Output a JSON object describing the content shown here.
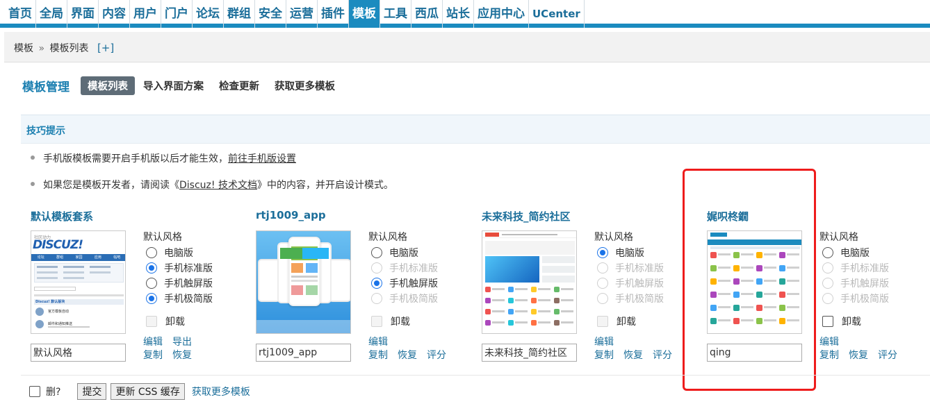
{
  "nav": {
    "items": [
      {
        "label": "首页",
        "active": false
      },
      {
        "label": "全局",
        "active": false
      },
      {
        "label": "界面",
        "active": false
      },
      {
        "label": "内容",
        "active": false
      },
      {
        "label": "用户",
        "active": false
      },
      {
        "label": "门户",
        "active": false
      },
      {
        "label": "论坛",
        "active": false
      },
      {
        "label": "群组",
        "active": false
      },
      {
        "label": "安全",
        "active": false
      },
      {
        "label": "运营",
        "active": false
      },
      {
        "label": "插件",
        "active": false
      },
      {
        "label": "模板",
        "active": true
      },
      {
        "label": "工具",
        "active": false
      },
      {
        "label": "西瓜",
        "active": false
      },
      {
        "label": "站长",
        "active": false
      },
      {
        "label": "应用中心",
        "active": false
      },
      {
        "label": "UCenter",
        "active": false
      }
    ]
  },
  "breadcrumb": {
    "root": "模板",
    "sep": "»",
    "current": "模板列表",
    "add": "[+]"
  },
  "subnav": {
    "heading": "模板管理",
    "tabs": [
      "模板列表",
      "导入界面方案",
      "检查更新",
      "获取更多模板"
    ]
  },
  "tips": {
    "title": "技巧提示",
    "line1_text": "手机版模板需要开启手机版以后才能生效，",
    "line1_link": "前往手机版设置",
    "line2_pre": "如果您是模板开发者，请阅读《",
    "line2_link": "Discuz! 技术文档",
    "line2_post": "》中的内容，并开启设计模式。"
  },
  "styles_label": "默认风格",
  "uninstall_label": "卸载",
  "templates": [
    {
      "name": "默认模板套系",
      "input_value": "默认风格",
      "options": [
        {
          "label": "电脑版",
          "checked": false,
          "disabled": false
        },
        {
          "label": "手机标准版",
          "checked": true,
          "disabled": false
        },
        {
          "label": "手机触屏版",
          "checked": false,
          "disabled": false
        },
        {
          "label": "手机极简版",
          "checked": true,
          "disabled": false
        }
      ],
      "uninstall_disabled": true,
      "links_row1": [
        "编辑",
        "导出"
      ],
      "links_row2": [
        "复制",
        "恢复"
      ]
    },
    {
      "name": "rtj1009_app",
      "input_value": "rtj1009_app",
      "options": [
        {
          "label": "电脑版",
          "checked": false,
          "disabled": false
        },
        {
          "label": "手机标准版",
          "checked": false,
          "disabled": true
        },
        {
          "label": "手机触屏版",
          "checked": true,
          "disabled": false
        },
        {
          "label": "手机极简版",
          "checked": false,
          "disabled": true
        }
      ],
      "uninstall_disabled": true,
      "links_row1": [
        "编辑"
      ],
      "links_row2": [
        "复制",
        "恢复",
        "评分"
      ]
    },
    {
      "name": "未来科技_简约社区",
      "input_value": "未来科技_简约社区",
      "options": [
        {
          "label": "电脑版",
          "checked": true,
          "disabled": false
        },
        {
          "label": "手机标准版",
          "checked": false,
          "disabled": true
        },
        {
          "label": "手机触屏版",
          "checked": false,
          "disabled": true
        },
        {
          "label": "手机极简版",
          "checked": false,
          "disabled": true
        }
      ],
      "uninstall_disabled": true,
      "links_row1": [
        "编辑"
      ],
      "links_row2": [
        "复制",
        "恢复",
        "评分"
      ]
    },
    {
      "name": "娓呮柊鐗",
      "input_value": "qing",
      "options": [
        {
          "label": "电脑版",
          "checked": false,
          "disabled": false
        },
        {
          "label": "手机标准版",
          "checked": false,
          "disabled": true
        },
        {
          "label": "手机触屏版",
          "checked": false,
          "disabled": true
        },
        {
          "label": "手机极简版",
          "checked": false,
          "disabled": true
        }
      ],
      "uninstall_disabled": false,
      "links_row1": [
        "编辑"
      ],
      "links_row2": [
        "复制",
        "恢复",
        "评分"
      ]
    }
  ],
  "thumb1": {
    "logo_top": "社区动力",
    "logo": "DISCUZ!",
    "tabs": [
      "论坛",
      "群组",
      "家园",
      "应用",
      "帖吧"
    ],
    "section": "Discuz! 默认版块",
    "item1": "官方模板自动",
    "item2": "邮件和通知推送"
  },
  "thumb2": {},
  "thumb3": {},
  "thumb4": {},
  "bottom": {
    "delete_label": "删?",
    "submit": "提交",
    "update_css": "更新 CSS 缓存",
    "more": "获取更多模板"
  },
  "colors": {
    "accent": "#1b8bbf",
    "link": "#1b6e9a",
    "annotation": "#ee1c1c"
  }
}
